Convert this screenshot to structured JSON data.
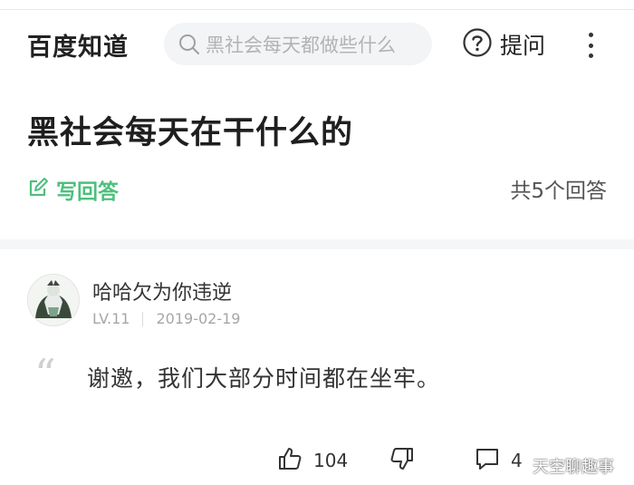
{
  "header": {
    "brand": "百度知道",
    "search_placeholder": "黑社会每天都做些什么",
    "ask_label": "提问"
  },
  "question": {
    "title": "黑社会每天在干什么的",
    "write_answer_label": "写回答",
    "answer_count": "共5个回答"
  },
  "answer": {
    "username": "哈哈欠为你违逆",
    "level": "LV.11",
    "date": "2019-02-19",
    "quote_mark": "“",
    "text": "谢邀，我们大部分时间都在坐牢。",
    "like_count": "104",
    "comment_count": "4"
  },
  "watermark": "天空聊趣事",
  "colors": {
    "accent_green": "#4ebf7d",
    "search_bg": "#f3f4f6",
    "separator": "#f5f6f7"
  },
  "icons": [
    "search-icon",
    "question-circle-icon",
    "more-vertical-icon",
    "edit-icon",
    "thumbs-up-icon",
    "thumbs-down-icon",
    "comment-icon"
  ]
}
